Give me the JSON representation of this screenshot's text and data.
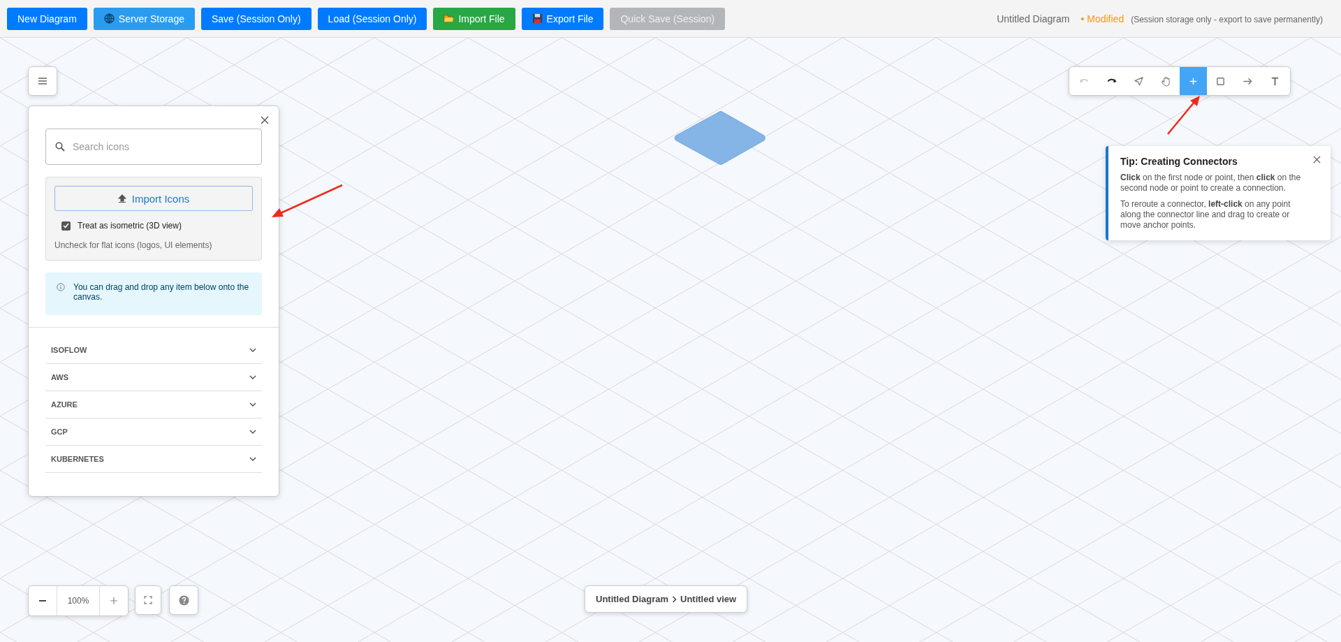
{
  "top_bar": {
    "buttons": [
      {
        "label": "New Diagram",
        "kind": "primary",
        "disabled": false
      },
      {
        "label": "Server Storage",
        "kind": "storage",
        "disabled": false
      },
      {
        "label": "Save (Session Only)",
        "kind": "primary",
        "disabled": false
      },
      {
        "label": "Load (Session Only)",
        "kind": "primary",
        "disabled": false
      },
      {
        "label": "Import File",
        "kind": "import",
        "disabled": false
      },
      {
        "label": "Export File",
        "kind": "export",
        "disabled": false
      },
      {
        "label": "Quick Save (Session)",
        "kind": "primary",
        "disabled": true
      }
    ],
    "document_title": "Untitled Diagram",
    "status": "• Modified",
    "storage_note": "(Session storage only - export to save permanently)"
  },
  "toolbar": {
    "tools": [
      {
        "kind": "undo",
        "selected": false,
        "disabled": true
      },
      {
        "kind": "redo",
        "selected": false,
        "disabled": false
      },
      {
        "kind": "select",
        "selected": false,
        "disabled": false
      },
      {
        "kind": "pan",
        "selected": false,
        "disabled": false
      },
      {
        "kind": "add",
        "selected": true,
        "disabled": false
      },
      {
        "kind": "rectangle",
        "selected": false,
        "disabled": false
      },
      {
        "kind": "connector",
        "selected": false,
        "disabled": false
      },
      {
        "kind": "text",
        "selected": false,
        "disabled": false
      }
    ]
  },
  "icon_panel": {
    "search": {
      "placeholder": "Search icons"
    },
    "import_button": "Import Icons",
    "isometric_option": {
      "label": "Treat as isometric (3D view)",
      "checked": true
    },
    "hint": "Uncheck for flat icons (logos, UI elements)",
    "info": "You can drag and drop any item below onto the canvas.",
    "sections": [
      {
        "label": "ISOFLOW",
        "expanded": false
      },
      {
        "label": "AWS",
        "expanded": false
      },
      {
        "label": "AZURE",
        "expanded": false
      },
      {
        "label": "GCP",
        "expanded": false
      },
      {
        "label": "KUBERNETES",
        "expanded": false
      }
    ]
  },
  "tip": {
    "title": "Tip: Creating Connectors",
    "paragraphs": [
      "**Click** on the first node or point, then **click** on the second node or point to create a connection.",
      "To reroute a connector, **left-click** on any point along the connector line and drag to create or move anchor points."
    ]
  },
  "zoom": {
    "value": "100%"
  },
  "breadcrumb": [
    "Untitled Diagram",
    "Untitled view"
  ]
}
